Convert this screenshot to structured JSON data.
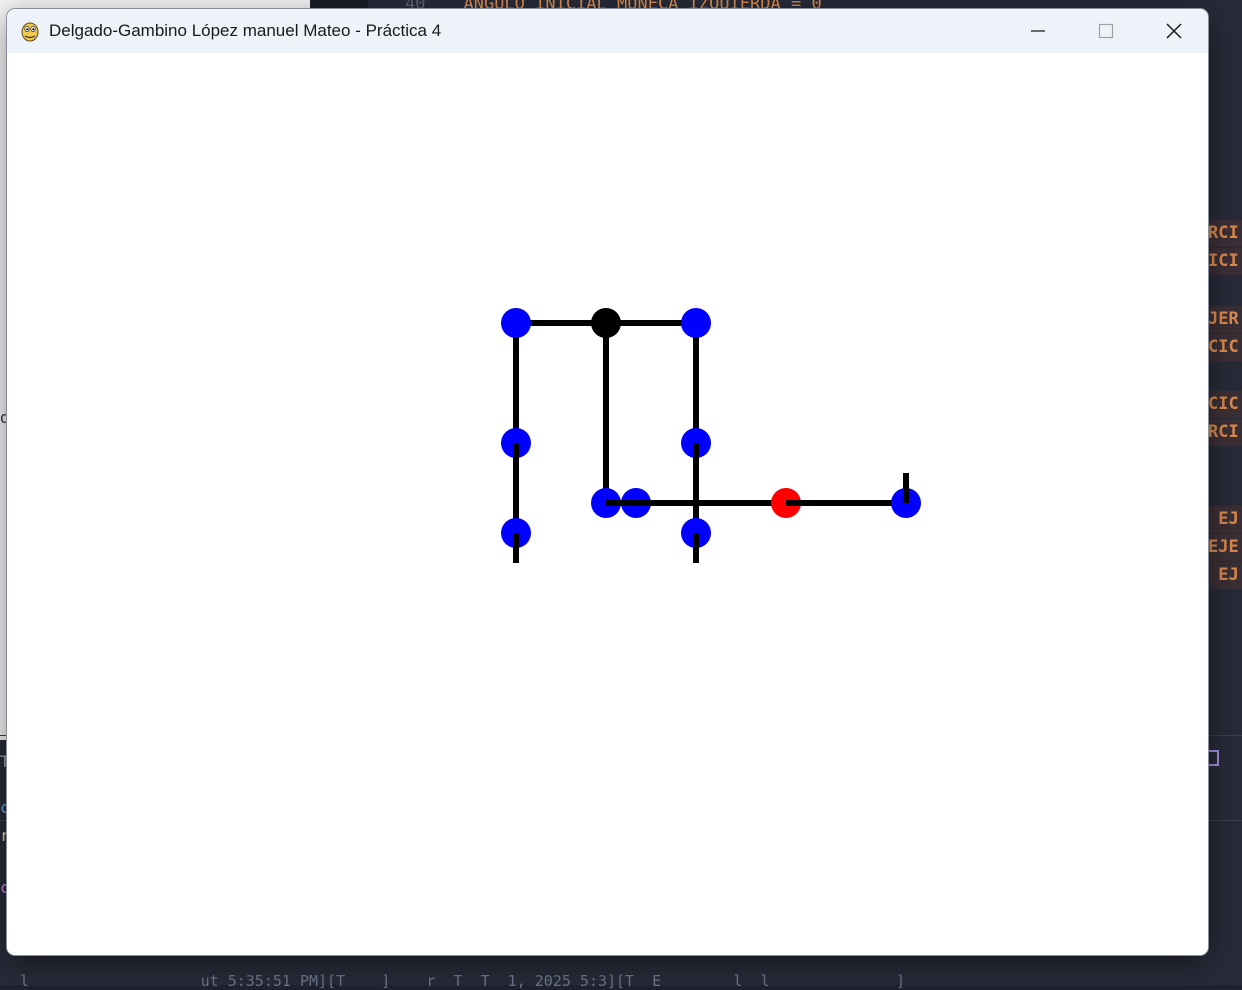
{
  "background": {
    "top_code_line_number": "40",
    "top_code_text": "ANGULO_INICIAL_MUNECA_IZQUIERDA = 0",
    "right_code_fragments": [
      "RCI",
      "ICI",
      "JER",
      "CIC",
      "CIC",
      "RCI",
      " EJ",
      "EJE",
      " EJ"
    ],
    "left_fragments": [
      "d",
      "T",
      "c",
      "r",
      "c"
    ],
    "terminal_text": "l                   ut 5:35:51 PM][T    ]    r  T  T  1, 2025 5:3][T  E        l  l              ]"
  },
  "window": {
    "title": "Delgado-Gambino López manuel Mateo - Práctica 4",
    "app_icon": "python-icon",
    "controls": [
      "minimize-icon",
      "maximize-icon",
      "close-icon"
    ]
  },
  "figure": {
    "colors": {
      "joint": "#0000ff",
      "center_joint": "#000000",
      "highlight_joint": "#ff0000",
      "bone": "#000000",
      "canvas_background": "#ffffff"
    },
    "joints": [
      {
        "name": "joint-top-left",
        "color": "joint"
      },
      {
        "name": "joint-top-center",
        "color": "center_joint"
      },
      {
        "name": "joint-top-right",
        "color": "joint"
      },
      {
        "name": "joint-left-mid",
        "color": "joint"
      },
      {
        "name": "joint-right-mid",
        "color": "joint"
      },
      {
        "name": "joint-center-low",
        "color": "joint"
      },
      {
        "name": "joint-center-low-2",
        "color": "joint"
      },
      {
        "name": "joint-left-low",
        "color": "joint"
      },
      {
        "name": "joint-right-low",
        "color": "joint"
      },
      {
        "name": "joint-arm-elbow",
        "color": "highlight_joint"
      },
      {
        "name": "joint-arm-hand",
        "color": "joint"
      }
    ]
  }
}
